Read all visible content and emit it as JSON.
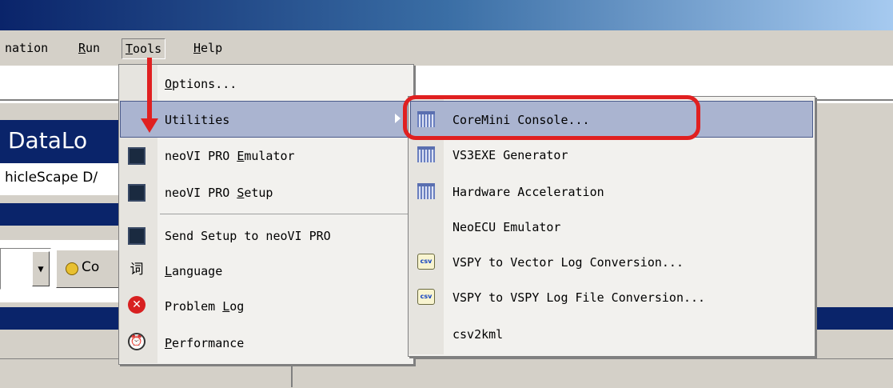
{
  "menubar": {
    "items": [
      {
        "pre": "",
        "ul": "",
        "post": "nation"
      },
      {
        "pre": "",
        "ul": "R",
        "post": "un"
      },
      {
        "pre": "",
        "ul": "T",
        "post": "ools"
      },
      {
        "pre": "",
        "ul": "H",
        "post": "elp"
      }
    ]
  },
  "background": {
    "panel_title": "DataLo",
    "panel_subtitle": "hicleScape D/",
    "combo_arrow": "▼",
    "co_label": "Co"
  },
  "tools_menu": {
    "items": [
      {
        "pre": "",
        "ul": "O",
        "post": "ptions..."
      },
      {
        "pre": "",
        "ul": "",
        "post": "Utilities"
      },
      {
        "pre": "neoVI PRO ",
        "ul": "E",
        "post": "mulator"
      },
      {
        "pre": "neoVI PRO ",
        "ul": "S",
        "post": "etup"
      },
      {
        "pre": "Send Setup to neoVI PRO",
        "ul": "",
        "post": ""
      },
      {
        "pre": "",
        "ul": "L",
        "post": "anguage"
      },
      {
        "pre": "Problem ",
        "ul": "L",
        "post": "og"
      },
      {
        "pre": "",
        "ul": "P",
        "post": "erformance"
      }
    ],
    "icons": {
      "language_glyph": "词",
      "problem_glyph": "✕",
      "performance_glyph": "⏰"
    }
  },
  "utilities_submenu": {
    "items": [
      "CoreMini Console...",
      "VS3EXE Generator",
      "Hardware Acceleration",
      "NeoECU Emulator",
      "VSPY to Vector Log Conversion...",
      "VSPY to VSPY Log File Conversion...",
      "csv2kml"
    ],
    "csv_icon_text": "csv"
  },
  "colors": {
    "highlight": "#aab4d0",
    "annotation_red": "#e02020",
    "title_gradient_start": "#0a246a"
  }
}
